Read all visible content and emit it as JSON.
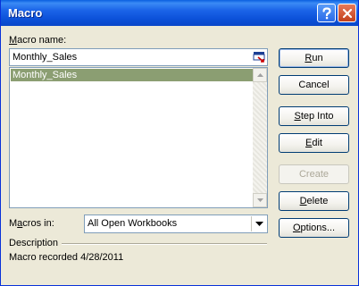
{
  "window": {
    "title": "Macro"
  },
  "macro_name": {
    "label": "Macro name:",
    "label_accel": "M",
    "label_rest": "acro name:",
    "value": "Monthly_Sales"
  },
  "macro_list": {
    "items": [
      "Monthly_Sales"
    ],
    "selected_index": 0
  },
  "macros_in": {
    "label_pre": "M",
    "label_accel": "a",
    "label_rest": "cros in:",
    "value": "All Open Workbooks"
  },
  "description": {
    "label": "Description",
    "text": "Macro recorded 4/28/2011"
  },
  "buttons": {
    "run": {
      "accel": "R",
      "rest": "un"
    },
    "cancel": {
      "label": "Cancel"
    },
    "step_into": {
      "accel": "S",
      "rest": "tep Into"
    },
    "edit": {
      "accel": "E",
      "rest": "dit"
    },
    "create": {
      "label": "Create"
    },
    "delete": {
      "accel": "D",
      "rest": "elete"
    },
    "options": {
      "accel": "O",
      "rest": "ptions..."
    }
  },
  "colors": {
    "title_bar": "#0a5fe0",
    "selection": "#8b9e72",
    "dialog_bg": "#ece9d8"
  }
}
